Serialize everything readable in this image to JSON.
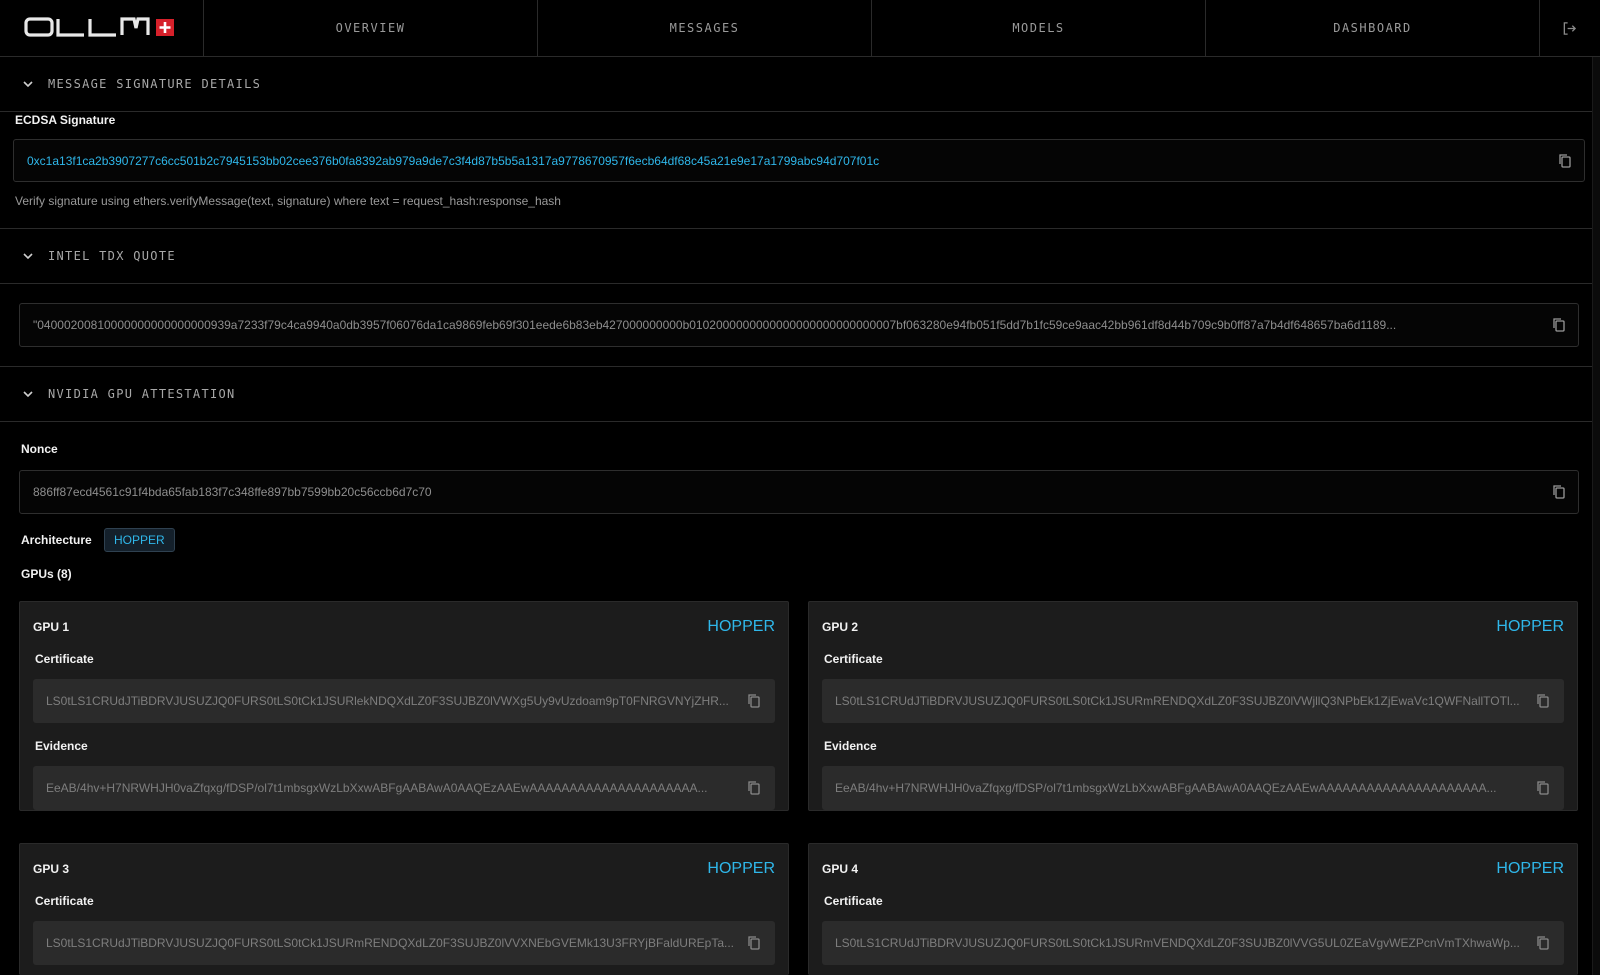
{
  "header": {
    "logo_text": "OLLM",
    "tabs": [
      {
        "label": "OVERVIEW"
      },
      {
        "label": "MESSAGES"
      },
      {
        "label": "MODELS"
      },
      {
        "label": "DASHBOARD"
      }
    ]
  },
  "signature_section": {
    "title": "MESSAGE SIGNATURE DETAILS",
    "label": "ECDSA Signature",
    "value": "0xc1a13f1ca2b3907277c6cc501b2c7945153bb02cee376b0fa8392ab979a9de7c3f4d87b5b5a1317a9778670957f6ecb64df68c45a21e9e17a1799abc94d707f01c",
    "hint": "Verify signature using ethers.verifyMessage(text, signature) where text = request_hash:response_hash"
  },
  "tdx_section": {
    "title": "INTEL TDX QUOTE",
    "value": "\"04000200810000000000000000939a7233f79c4ca9940a0db3957f06076da1ca9869feb69f301eede6b83eb427000000000b0102000000000000000000000000007bf063280e94fb051f5dd7b1fc59ce9aac42bb961df8d44b709c9b0ff87a7b4df648657ba6d1189..."
  },
  "gpu_section": {
    "title": "NVIDIA GPU ATTESTATION",
    "nonce_label": "Nonce",
    "nonce": "886ff87ecd4561c91f4bda65fab183f7c348ffe897bb7599bb20c56ccb6d7c70",
    "architecture_label": "Architecture",
    "architecture": "HOPPER",
    "gpus_label": "GPUs (8)",
    "certificate_label": "Certificate",
    "evidence_label": "Evidence",
    "gpus": [
      {
        "name": "GPU 1",
        "arch": "HOPPER",
        "certificate": "LS0tLS1CRUdJTiBDRVJUSUZJQ0FURS0tLS0tCk1JSURlekNDQXdLZ0F3SUJBZ0lVWXg5Uy9vUzdoam9pT0FNRGVNYjZHR...",
        "evidence": "EeAB/4hv+H7NRWHJH0vaZfqxg/fDSP/ol7t1mbsgxWzLbXxwABFgAABAwA0AAQEzAAEwAAAAAAAAAAAAAAAAAAAAA..."
      },
      {
        "name": "GPU 2",
        "arch": "HOPPER",
        "certificate": "LS0tLS1CRUdJTiBDRVJUSUZJQ0FURS0tLS0tCk1JSURmRENDQXdLZ0F3SUJBZ0lVWjllQ3NPbEk1ZjEwaVc1QWFNallTOTl...",
        "evidence": "EeAB/4hv+H7NRWHJH0vaZfqxg/fDSP/ol7t1mbsgxWzLbXxwABFgAABAwA0AAQEzAAEwAAAAAAAAAAAAAAAAAAAAA..."
      },
      {
        "name": "GPU 3",
        "arch": "HOPPER",
        "certificate": "LS0tLS1CRUdJTiBDRVJUSUZJQ0FURS0tLS0tCk1JSURmRENDQXdLZ0F3SUJBZ0lVVXNEbGVEMk13U3FRYjBFaldUREpTa..."
      },
      {
        "name": "GPU 4",
        "arch": "HOPPER",
        "certificate": "LS0tLS1CRUdJTiBDRVJUSUZJQ0FURS0tLS0tCk1JSURmVENDQXdLZ0F3SUJBZ0lVVG5UL0ZEaVgvWEZPcnVmTXhwaWp..."
      }
    ]
  },
  "colors": {
    "accent": "#2fb7ea",
    "background": "#000000",
    "card": "#1c1c1c",
    "border": "#2a2a2a"
  }
}
